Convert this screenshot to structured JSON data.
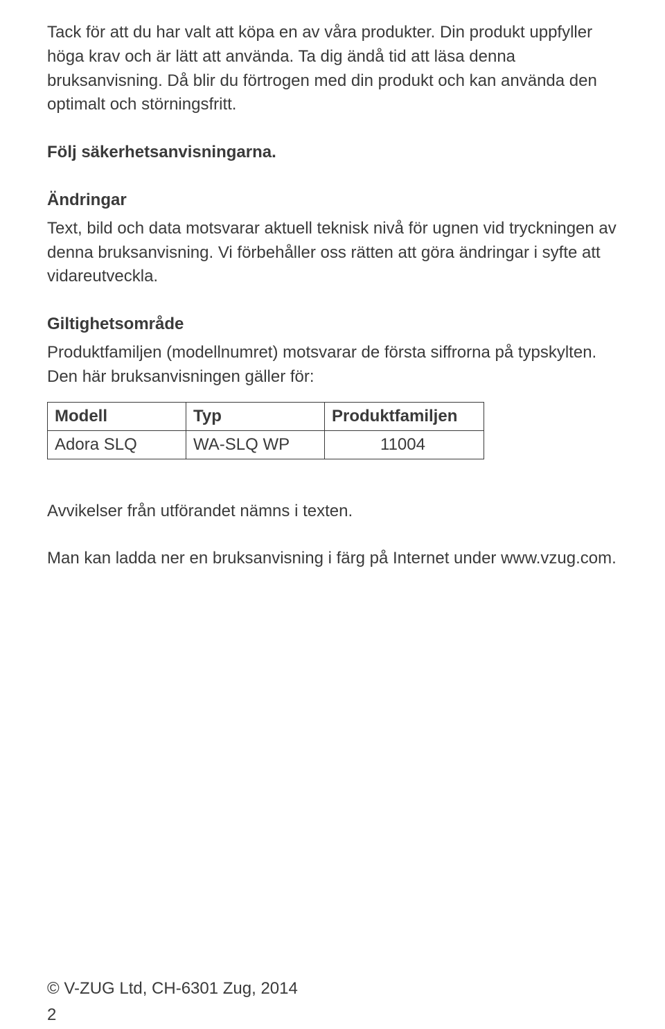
{
  "intro": "Tack för att du har valt att köpa en av våra produkter. Din produkt uppfyller höga krav och är lätt att använda. Ta dig ändå tid att läsa denna bruksanvisning. Då blir du förtrogen med din produkt och kan använda den optimalt och störningsfritt.",
  "follow": "Följ säkerhetsanvisningarna.",
  "changes_heading": "Ändringar",
  "changes_body": "Text, bild och data motsvarar aktuell teknisk nivå för ugnen vid tryckningen av denna bruksanvisning. Vi förbehåller oss rätten att göra ändringar i syfte att vidareutveckla.",
  "scope_heading": "Giltighetsområde",
  "scope_body": "Produktfamiljen (modellnumret) motsvarar de första siffrorna på typskylten. Den här bruksanvisningen gäller för:",
  "table": {
    "headers": [
      "Modell",
      "Typ",
      "Produktfamiljen"
    ],
    "row": [
      "Adora SLQ",
      "WA-SLQ WP",
      "11004"
    ]
  },
  "deviation": "Avvikelser från utförandet nämns i texten.",
  "download": "Man kan ladda ner en bruksanvisning i färg på Internet under www.vzug.com.",
  "copyright": "© V-ZUG Ltd, CH-6301 Zug, 2014",
  "page_number": "2"
}
